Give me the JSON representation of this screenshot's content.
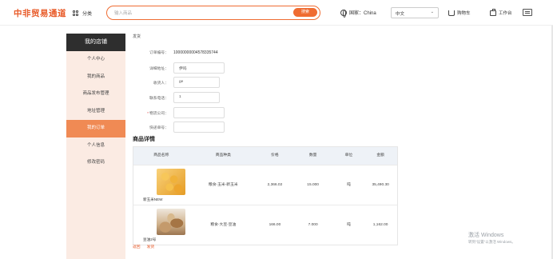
{
  "header": {
    "logo": "中非贸易通道",
    "category_label": "分类",
    "search_placeholder": "输入商品",
    "search_button": "搜索",
    "country_label": "国家：China",
    "language": "中文",
    "cart_label": "购物车",
    "workbench_label": "工作台"
  },
  "sidebar": {
    "title": "我的店铺",
    "items": [
      {
        "label": "个人中心"
      },
      {
        "label": "我的商品"
      },
      {
        "label": "商品发布管理"
      },
      {
        "label": "地址管理"
      },
      {
        "label": "我的订单"
      },
      {
        "label": "个人信息"
      },
      {
        "label": "修改密码"
      }
    ],
    "active_index": 4
  },
  "main": {
    "breadcrumb": "发货",
    "form": {
      "order_no_label": "订单编号：",
      "order_no_value": "1000000000457833574​4",
      "address_label": "详细地址：",
      "address_value": "伊吗",
      "recipient_label": "收货人：",
      "recipient_value": "ge",
      "phone_label": "联系电话：",
      "phone_value": "1",
      "logistics_label": "物流公司：",
      "logistics_value": "",
      "tracking_label": "快递单号：",
      "tracking_value": ""
    },
    "section_title": "商品详情",
    "table": {
      "headers": [
        "商品名称",
        "商品种类",
        "价格",
        "数量",
        "单位",
        "金额"
      ],
      "rows": [
        {
          "name": "新玉米NEW",
          "category": "粮食-玉米-新玉米",
          "price": "2,366.02",
          "qty": "15.000",
          "unit": "吨",
          "amount": "35,490.30"
        },
        {
          "name": "豆油2号",
          "category": "粮食-大豆-豆油",
          "price": "166.00",
          "qty": "7.000",
          "unit": "吨",
          "amount": "1,162.00"
        }
      ]
    },
    "pager": {
      "prev": "返回",
      "next": "发货"
    }
  },
  "watermark": {
    "line1": "激活 Windows",
    "line2": "转到\"设置\"以激活 Windows。"
  }
}
